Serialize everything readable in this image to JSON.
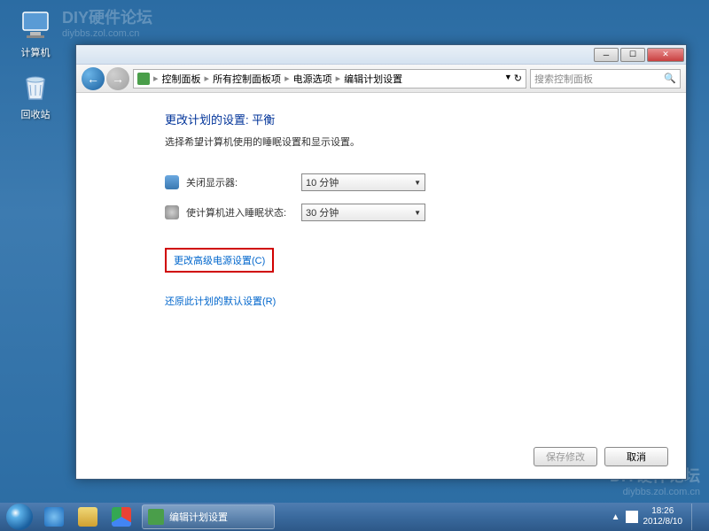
{
  "desktop": {
    "computer_label": "计算机",
    "recycle_label": "回收站"
  },
  "watermark": {
    "title": "DIY硬件论坛",
    "url": "diybbs.zol.com.cn"
  },
  "window": {
    "breadcrumb": {
      "items": [
        "控制面板",
        "所有控制面板项",
        "电源选项",
        "编辑计划设置"
      ]
    },
    "search_placeholder": "搜索控制面板",
    "heading": "更改计划的设置: 平衡",
    "subtitle": "选择希望计算机使用的睡眠设置和显示设置。",
    "settings": {
      "display_off_label": "关闭显示器:",
      "display_off_value": "10 分钟",
      "sleep_label": "使计算机进入睡眠状态:",
      "sleep_value": "30 分钟"
    },
    "links": {
      "advanced": "更改高级电源设置(C)",
      "restore": "还原此计划的默认设置(R)"
    },
    "buttons": {
      "save": "保存修改",
      "cancel": "取消"
    }
  },
  "taskbar": {
    "app_title": "编辑计划设置",
    "time": "18:26",
    "date": "2012/8/10"
  }
}
